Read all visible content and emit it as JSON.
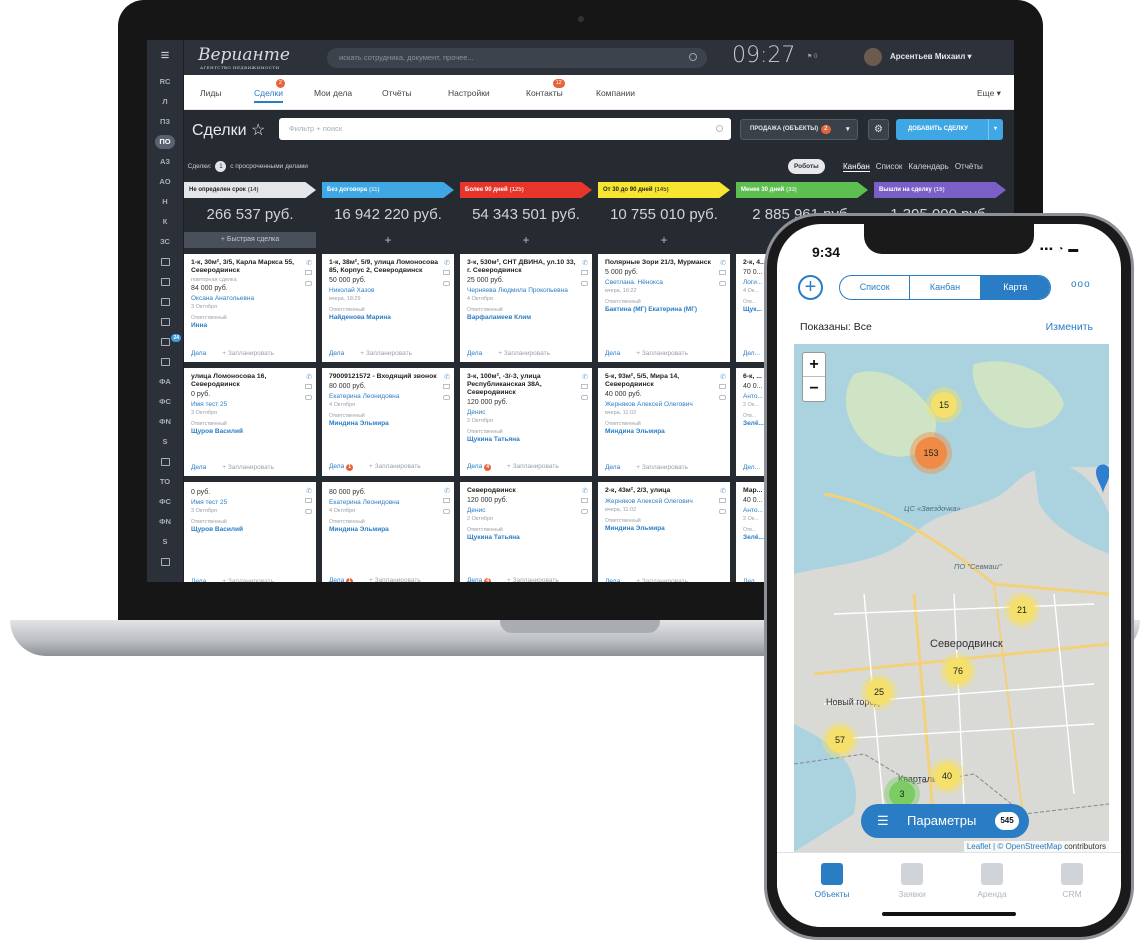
{
  "laptop": {
    "rail": [
      "RC",
      "Л",
      "ПЗ",
      "ПО",
      "АЗ",
      "АО",
      "Н",
      "К",
      "ЗС",
      "",
      "",
      "",
      "",
      "",
      "",
      "ФА",
      "ФС",
      "ФN",
      "S",
      "",
      "ТО",
      "ФС",
      "ФN",
      "S",
      ""
    ],
    "rail_badge": "24",
    "logo": "Верианте",
    "logo_since": "с 1998",
    "logo_sub": "АГЕНТСТВО НЕДВИЖИМОСТИ",
    "search_placeholder": "искать сотрудника, документ, прочее...",
    "clock": "09:27",
    "flag_count": "0",
    "user_name": "Арсентьев Михаил",
    "nav": [
      {
        "label": "Лиды",
        "badge": ""
      },
      {
        "label": "Сделки",
        "badge": "2"
      },
      {
        "label": "Мои дела",
        "badge": ""
      },
      {
        "label": "Отчёты",
        "badge": ""
      },
      {
        "label": "Настройки",
        "badge": ""
      },
      {
        "label": "Контакты",
        "badge": "12"
      },
      {
        "label": "Компании",
        "badge": ""
      }
    ],
    "nav_more": "Еще",
    "page_title": "Сделки",
    "filter_placeholder": "Фильтр + поиск",
    "sale_label": "ПРОДАЖА (ОБЪЕКТЫ)",
    "sale_badge": "2",
    "add_deal": "ДОБАВИТЬ СДЕЛКУ",
    "summary_prefix": "Сделки:",
    "summary_count": "1",
    "summary_suffix": "с просроченными делами",
    "robots": "Роботы",
    "views": [
      "Канбан",
      "Список",
      "Календарь",
      "Отчёты"
    ],
    "quick_deal": "+ Быстрая сделка",
    "columns": [
      {
        "title": "Не определен срок",
        "count": "(14)",
        "color": "#e4e6e9",
        "text": "#222",
        "sum": "266 537 руб.",
        "cards": [
          {
            "title": "1-к, 30м², 3/5, Карла Маркса 55, Северодвинск",
            "sub": "повторная сделка",
            "price": "84 000 руб.",
            "contact": "Оксана Анатольевна",
            "date": "3 Октября",
            "resp_label": "Ответственный",
            "resp": "Инна",
            "deals": "Дела",
            "plan": "+ Запланировать",
            "badge": ""
          },
          {
            "title": "улица Ломоносова 16, Северодвинск",
            "sub": "",
            "price": "0 руб.",
            "contact": "Имя тест 25",
            "date": "3 Октября",
            "resp_label": "Ответственный",
            "resp": "Щуров Василий",
            "deals": "Дела",
            "plan": "+ Запланировать",
            "badge": ""
          },
          {
            "title": "",
            "sub": "",
            "price": "0 руб.",
            "contact": "Имя тест 25",
            "date": "3 Октября",
            "resp_label": "Ответственный",
            "resp": "Щуров Василий",
            "deals": "Дела",
            "plan": "+ Запланировать",
            "badge": ""
          }
        ]
      },
      {
        "title": "Без договора",
        "count": "(11)",
        "color": "#3ea7e4",
        "text": "#fff",
        "sum": "16 942 220 руб.",
        "cards": [
          {
            "title": "1-к, 38м², 5/9, улица Ломоносова 85, Корпус 2, Северодвинск",
            "sub": "",
            "price": "50 000 руб.",
            "contact": "Николай Хазов",
            "date": "вчера, 18:29",
            "resp_label": "Ответственный",
            "resp": "Найденова Марина",
            "deals": "Дела",
            "plan": "+ Запланировать",
            "badge": ""
          },
          {
            "title": "79009121572 - Входящий звонок",
            "sub": "",
            "price": "80 000 руб.",
            "contact": "Екатерина Леонидовна",
            "date": "4 Октября",
            "resp_label": "Ответственный",
            "resp": "Миндина Эльмира",
            "deals": "Дела",
            "plan": "+ Запланировать",
            "badge": "1"
          },
          {
            "title": "",
            "sub": "",
            "price": "80 000 руб.",
            "contact": "Екатерина Леонидовна",
            "date": "4 Октября",
            "resp_label": "Ответственный",
            "resp": "Миндина Эльмира",
            "deals": "Дела",
            "plan": "+ Запланировать",
            "badge": "1"
          }
        ]
      },
      {
        "title": "Более 90 дней",
        "count": "(125)",
        "color": "#e8352b",
        "text": "#fff",
        "sum": "54 343 501 руб.",
        "cards": [
          {
            "title": "3-к, 530м², СНТ ДВИНА, ул.10 33, г. Северодвинск",
            "sub": "",
            "price": "25 000 руб.",
            "contact": "Черняева Людмила Прокопьевна",
            "date": "4 Октября",
            "resp_label": "Ответственный",
            "resp": "Варфаламеев Клим",
            "deals": "Дела",
            "plan": "+ Запланировать",
            "badge": ""
          },
          {
            "title": "3-к, 100м², -3/-3, улица Республиканская 38А, Северодвинск",
            "sub": "",
            "price": "120 000 руб.",
            "contact": "Денис",
            "date": "2 Октября",
            "resp_label": "Ответственный",
            "resp": "Щукина Татьяна",
            "deals": "Дела",
            "plan": "+ Запланировать",
            "badge": "4"
          },
          {
            "title": "Северодвинск",
            "sub": "",
            "price": "120 000 руб.",
            "contact": "Денис",
            "date": "2 Октября",
            "resp_label": "Ответственный",
            "resp": "Щукина Татьяна",
            "deals": "Дела",
            "plan": "+ Запланировать",
            "badge": "4"
          }
        ]
      },
      {
        "title": "От 30 до 90 дней",
        "count": "(145)",
        "color": "#f7e531",
        "text": "#222",
        "sum": "10 755 010 руб.",
        "cards": [
          {
            "title": "Полярные Зори 21/3, Мурманск",
            "sub": "",
            "price": "5 000 руб.",
            "contact": "Светлана. Нёнокса",
            "date": "вчера, 16:22",
            "resp_label": "Ответственный",
            "resp": "Бактина (МГ) Екатерина (МГ)",
            "deals": "Дела",
            "plan": "+ Запланировать",
            "badge": ""
          },
          {
            "title": "5-к, 93м², 5/5, Мира 14, Северодвинск",
            "sub": "",
            "price": "40 000 руб.",
            "contact": "Жерняков Алексей Олегович",
            "date": "вчера, 11:02",
            "resp_label": "Ответственный",
            "resp": "Миндина Эльмира",
            "deals": "Дела",
            "plan": "+ Запланировать",
            "badge": ""
          },
          {
            "title": "2-к, 43м², 2/3, улица",
            "sub": "",
            "price": "",
            "contact": "Жерняков Алексей Олегович",
            "date": "вчера, 11:02",
            "resp_label": "Ответственный",
            "resp": "Миндина Эльмира",
            "deals": "Дела",
            "plan": "+ Запланировать",
            "badge": ""
          }
        ]
      },
      {
        "title": "Менее 30 дней",
        "count": "(33)",
        "color": "#5cbf4f",
        "text": "#fff",
        "sum": "2 885 961 руб.",
        "cards": [
          {
            "title": "2-к, 4... Русан... Севе...",
            "sub": "",
            "price": "70 0...",
            "contact": "Логи... Вени...",
            "date": "4 Ок...",
            "resp_label": "Отв...",
            "resp": "Щук...",
            "deals": "Дел...",
            "plan": "",
            "badge": ""
          },
          {
            "title": "6-к, ... Мар...",
            "sub": "",
            "price": "40 0...",
            "contact": "Анто...",
            "date": "2 Ок...",
            "resp_label": "Отв...",
            "resp": "Зелё...",
            "deals": "Дел...",
            "plan": "",
            "badge": ""
          },
          {
            "title": "Мар...",
            "sub": "",
            "price": "40 0...",
            "contact": "Анто...",
            "date": "2 Ок...",
            "resp_label": "Отв...",
            "resp": "Зелё...",
            "deals": "Дел...",
            "plan": "",
            "badge": ""
          }
        ]
      },
      {
        "title": "Вышли на сделку",
        "count": "(16)",
        "color": "#7a5fc8",
        "text": "#fff",
        "sum": "1 395 000 руб.",
        "cards": []
      }
    ]
  },
  "phone": {
    "time": "9:34",
    "status_icons": "▪▪▪ ◔ ▬",
    "add_symbol": "+",
    "tabs": [
      "Список",
      "Канбан",
      "Карта"
    ],
    "more": "ooo",
    "shown": "Показаны: Все",
    "change": "Изменить",
    "zoom_in": "+",
    "zoom_out": "−",
    "clusters": [
      {
        "value": "15",
        "kind": "yellow"
      },
      {
        "value": "153",
        "kind": "orange"
      },
      {
        "value": "21",
        "kind": "yellow"
      },
      {
        "value": "76",
        "kind": "yellow"
      },
      {
        "value": "25",
        "kind": "yellow"
      },
      {
        "value": "57",
        "kind": "yellow"
      },
      {
        "value": "40",
        "kind": "yellow"
      },
      {
        "value": "3",
        "kind": "green"
      }
    ],
    "labels": [
      "ЦС «Звездочка»",
      "ПО \"Севмаш\""
    ],
    "city": "Северодвинск",
    "district1": "Новый город",
    "district2": "Кварталы",
    "params_label": "Параметры",
    "params_count": "545",
    "attribution_prefix": "Leaflet | ©",
    "attribution_link": "OpenStreetMap",
    "attribution_suffix": "contributors",
    "tabbar": [
      {
        "label": "Объекты",
        "icon": "buildings-icon"
      },
      {
        "label": "Заявки",
        "icon": "list-icon"
      },
      {
        "label": "Аренда",
        "icon": "calendar-icon"
      },
      {
        "label": "CRM",
        "icon": "cloud-icon"
      }
    ]
  },
  "colors": {
    "accent": "#2a7dc5",
    "button": "#3ea7e4",
    "badge": "#e5643a"
  }
}
